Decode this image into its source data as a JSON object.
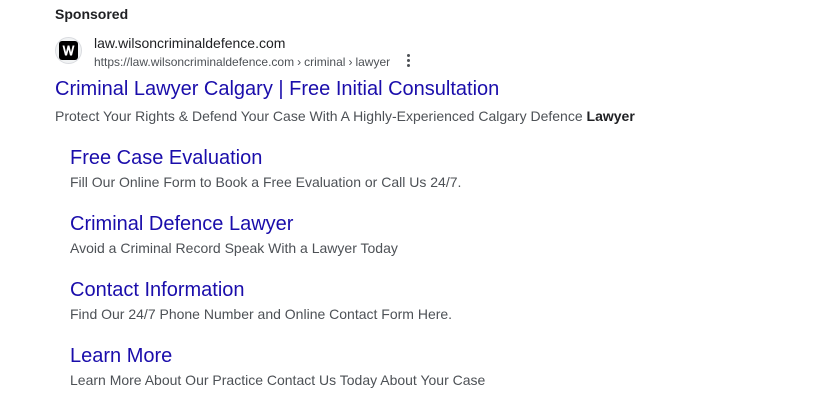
{
  "ad": {
    "sponsored_label": "Sponsored",
    "site_name": "law.wilsoncriminaldefence.com",
    "breadcrumb": {
      "domain": "https://law.wilsoncriminaldefence.com",
      "separator": "›",
      "segments": [
        "criminal",
        "lawyer"
      ]
    },
    "favicon_letter": "W",
    "title": "Criminal Lawyer Calgary | Free Initial Consultation",
    "description_prefix": "Protect Your Rights & Defend Your Case With A Highly-Experienced Calgary Defence",
    "description_bold": "Lawyer",
    "more_options_icon": "more-vert-icon"
  },
  "sitelinks": [
    {
      "title": "Free Case Evaluation",
      "description": "Fill Our Online Form to Book a Free Evaluation or Call Us 24/7."
    },
    {
      "title": "Criminal Defence Lawyer",
      "description": "Avoid a Criminal Record Speak With a Lawyer Today"
    },
    {
      "title": "Contact Information",
      "description": "Find Our 24/7 Phone Number and Online Contact Form Here."
    },
    {
      "title": "Learn More",
      "description": "Learn More About Our Practice Contact Us Today About Your Case"
    }
  ],
  "colors": {
    "link": "#1a0dab",
    "text": "#202124",
    "muted": "#4d5156"
  }
}
